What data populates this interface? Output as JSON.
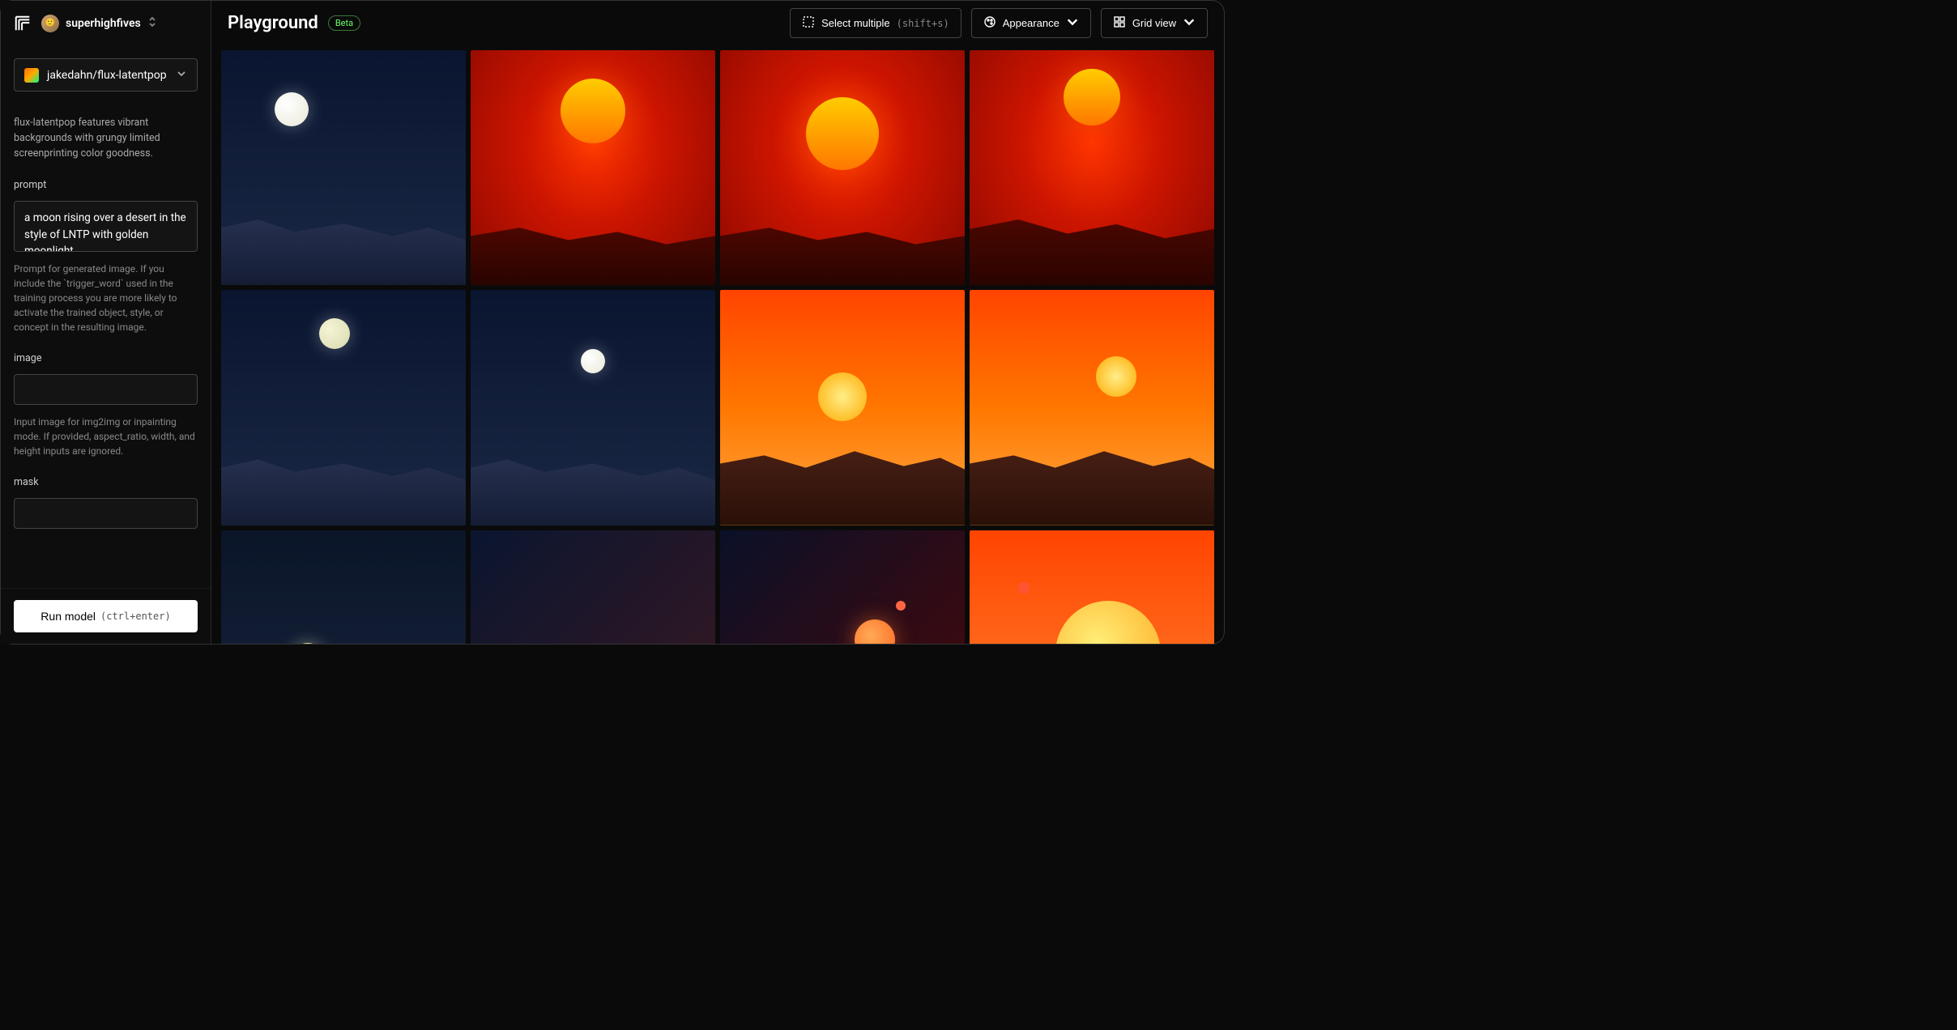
{
  "header": {
    "username": "superhighfives"
  },
  "sidebar": {
    "model_name": "jakedahn/flux-latentpop",
    "description": "flux-latentpop features vibrant backgrounds with grungy limited screenprinting color goodness.",
    "prompt_label": "prompt",
    "prompt_value": "a moon rising over a desert in the style of LNTP with golden moonlight",
    "prompt_help": "Prompt for generated image. If you include the `trigger_word` used in the training process you are more likely to activate the trained object, style, or concept in the resulting image.",
    "image_label": "image",
    "image_value": "",
    "image_help": "Input image for img2img or inpainting mode. If provided, aspect_ratio, width, and height inputs are ignored.",
    "mask_label": "mask",
    "mask_value": "",
    "run_label": "Run model",
    "run_kbd": "(ctrl+enter)"
  },
  "topbar": {
    "title": "Playground",
    "badge": "Beta",
    "select_multiple": "Select multiple",
    "select_kbd": "(shift+s)",
    "appearance": "Appearance",
    "grid_view": "Grid view"
  },
  "grid": {
    "tiles": [
      {
        "variant": "t-moon"
      },
      {
        "variant": "t-sun"
      },
      {
        "variant": "t-sun v2"
      },
      {
        "variant": "t-sun v3"
      },
      {
        "variant": "t-moon v2"
      },
      {
        "variant": "t-moon v4"
      },
      {
        "variant": "t-sunset"
      },
      {
        "variant": "t-sunset v2"
      },
      {
        "variant": "t-ymoon"
      },
      {
        "variant": "t-pmoon"
      },
      {
        "variant": "t-rmoon"
      },
      {
        "variant": "t-bigsun"
      }
    ]
  }
}
